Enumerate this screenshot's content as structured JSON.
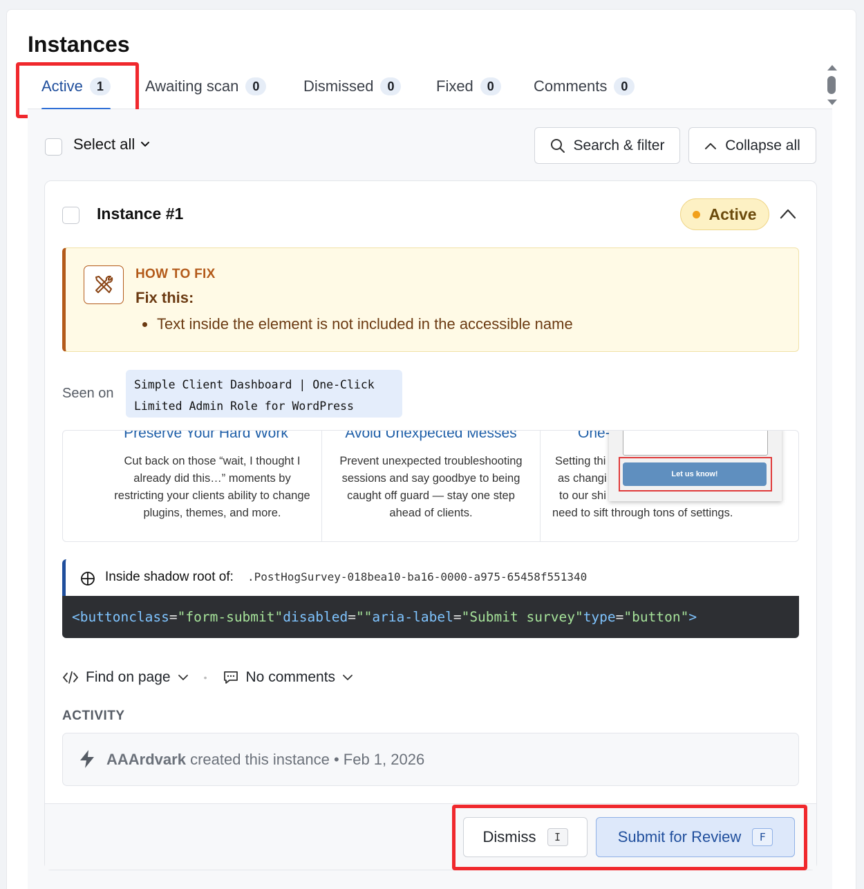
{
  "page": {
    "title": "Instances"
  },
  "tabs": [
    {
      "label": "Active",
      "count": "1"
    },
    {
      "label": "Awaiting scan",
      "count": "0"
    },
    {
      "label": "Dismissed",
      "count": "0"
    },
    {
      "label": "Fixed",
      "count": "0"
    },
    {
      "label": "Comments",
      "count": "0"
    }
  ],
  "toolbar": {
    "select_all": "Select all",
    "search_filter": "Search & filter",
    "collapse_all": "Collapse all"
  },
  "instance": {
    "title": "Instance #1",
    "status": "Active",
    "how_to_fix": {
      "heading": "HOW TO FIX",
      "subheading": "Fix this:",
      "items": [
        "Text inside the element is not included in the accessible name"
      ]
    },
    "seen_on": {
      "label": "Seen on",
      "page_line1": "Simple Client Dashboard | One-Click",
      "page_line2": "Limited Admin Role for WordPress"
    },
    "preview": {
      "col1_title": "Preserve Your Hard Work",
      "col1_text": "Cut back on those “wait, I thought I already did this…” moments by restricting your clients ability to change plugins, themes, and more.",
      "col2_title": "Avoid Unexpected Messes",
      "col2_text": "Prevent unexpected troubleshooting sessions and say goodbye to being caught off guard — stay one step ahead of clients.",
      "col3_title": "One-",
      "col3_line1": "Setting thi",
      "col3_line2": "as changi",
      "col3_line3": "to our shi",
      "col3_line4": "need to sift through tons of settings.",
      "popup_button": "Let us know!"
    },
    "shadow_root": {
      "label": "Inside shadow root of:",
      "selector": ".PostHogSurvey-018bea10-ba16-0000-a975-65458f551340"
    },
    "code": {
      "tag_open": "<button",
      "attr1_name": "class",
      "attr1_value": "\"form-submit\"",
      "attr2_name": "disabled",
      "attr2_value": "\"\"",
      "attr3_name": "aria-label",
      "attr3_value": "\"Submit survey\"",
      "attr4_name": "type",
      "attr4_value": "\"button\"",
      "tag_close": ">"
    },
    "find_on_page": "Find on page",
    "comments": "No comments",
    "activity": {
      "label": "ACTIVITY",
      "actor": "AAArdvark",
      "action": "created this instance • Feb 1, 2026"
    },
    "actions": {
      "dismiss_label": "Dismiss",
      "dismiss_key": "I",
      "submit_label": "Submit for Review",
      "submit_key": "F"
    }
  },
  "colors": {
    "accent": "#2f6fd6",
    "highlight": "#f0282d",
    "status_bg": "#fdf1c4",
    "fix_accent": "#b35a1a"
  }
}
